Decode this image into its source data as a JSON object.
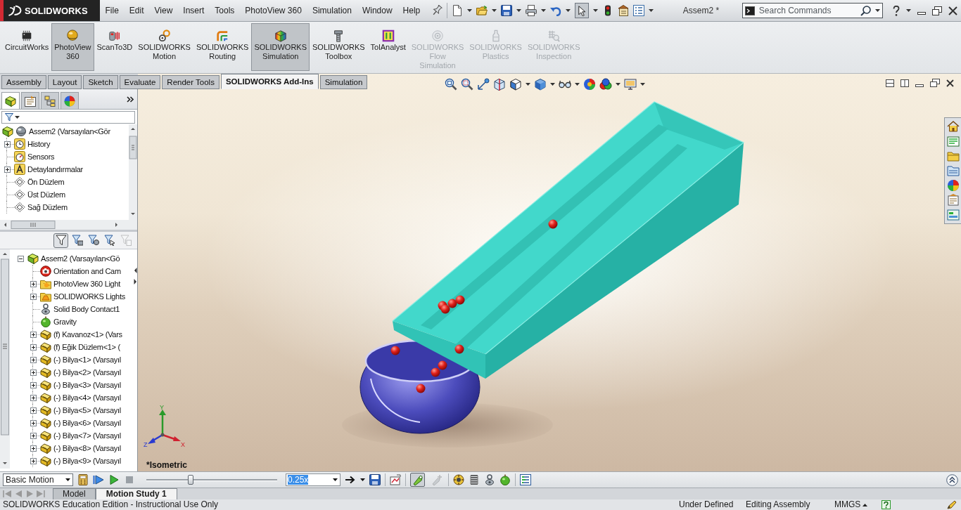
{
  "title_bar": {
    "logo": "SOLIDWORKS",
    "menu": [
      "File",
      "Edit",
      "View",
      "Insert",
      "Tools",
      "PhotoView 360",
      "Simulation",
      "Window",
      "Help"
    ],
    "select_tool_on": true,
    "document_title": "Assem2 *",
    "search": {
      "placeholder": "Search Commands"
    }
  },
  "command_manager": {
    "buttons": [
      {
        "label": "CircuitWorks",
        "selected": false,
        "disabled": false
      },
      {
        "label": "PhotoView 360",
        "selected": true,
        "disabled": false
      },
      {
        "label": "ScanTo3D",
        "selected": false,
        "disabled": false
      },
      {
        "label": "SOLIDWORKS Motion",
        "selected": false,
        "disabled": false
      },
      {
        "label": "SOLIDWORKS Routing",
        "selected": false,
        "disabled": false
      },
      {
        "label": "SOLIDWORKS Simulation",
        "selected": true,
        "disabled": false
      },
      {
        "label": "SOLIDWORKS Toolbox",
        "selected": false,
        "disabled": false
      },
      {
        "label": "TolAnalyst",
        "selected": false,
        "disabled": false
      },
      {
        "label": "SOLIDWORKS Flow Simulation",
        "selected": false,
        "disabled": true
      },
      {
        "label": "SOLIDWORKS Plastics",
        "selected": false,
        "disabled": true
      },
      {
        "label": "SOLIDWORKS Inspection",
        "selected": false,
        "disabled": true
      }
    ]
  },
  "tabs": [
    {
      "label": "Assembly",
      "selected": false
    },
    {
      "label": "Layout",
      "selected": false
    },
    {
      "label": "Sketch",
      "selected": false
    },
    {
      "label": "Evaluate",
      "selected": false
    },
    {
      "label": "Render Tools",
      "selected": false
    },
    {
      "label": "SOLIDWORKS Add-Ins",
      "selected": true
    },
    {
      "label": "Simulation",
      "selected": false
    }
  ],
  "feature_manager": {
    "panel_tabs": [
      {
        "selected": true
      },
      {
        "selected": false
      },
      {
        "selected": false
      },
      {
        "selected": false
      }
    ],
    "tree": [
      {
        "label": "Assem2 (Varsayılan<Gör",
        "kind": "root",
        "children": [
          {
            "label": "History",
            "kind": "history",
            "expanded": false
          },
          {
            "label": "Sensors",
            "kind": "sensors"
          },
          {
            "label": "Detaylandırmalar",
            "kind": "annotations",
            "expanded": false
          },
          {
            "label": "Ön Düzlem",
            "kind": "plane"
          },
          {
            "label": "Üst Düzlem",
            "kind": "plane"
          },
          {
            "label": "Sağ Düzlem",
            "kind": "plane"
          }
        ]
      }
    ]
  },
  "motion_manager": {
    "filters": [
      {
        "on": true,
        "disabled": false
      },
      {
        "on": false,
        "disabled": false
      },
      {
        "on": false,
        "disabled": false
      },
      {
        "on": false,
        "disabled": false
      },
      {
        "on": false,
        "disabled": true
      }
    ],
    "tree": [
      {
        "label": "Assem2 (Varsayılan<Gö",
        "kind": "assembly",
        "expanded": true,
        "children": [
          {
            "label": "Orientation and Cam",
            "kind": "orientation"
          },
          {
            "label": "PhotoView 360 Light",
            "kind": "lights",
            "expanded": false
          },
          {
            "label": "SOLIDWORKS Lights",
            "kind": "swlights",
            "expanded": false
          },
          {
            "label": "Solid Body Contact1",
            "kind": "contact"
          },
          {
            "label": "Gravity",
            "kind": "gravity"
          },
          {
            "label": "(f) Kavanoz<1> (Vars",
            "kind": "part",
            "expanded": false
          },
          {
            "label": "(f) Eğik Düzlem<1> (",
            "kind": "part",
            "expanded": false
          },
          {
            "label": "(-) Bilya<1> (Varsayıl",
            "kind": "part",
            "expanded": false
          },
          {
            "label": "(-) Bilya<2> (Varsayıl",
            "kind": "part",
            "expanded": false
          },
          {
            "label": "(-) Bilya<3> (Varsayıl",
            "kind": "part",
            "expanded": false
          },
          {
            "label": "(-) Bilya<4> (Varsayıl",
            "kind": "part",
            "expanded": false
          },
          {
            "label": "(-) Bilya<5> (Varsayıl",
            "kind": "part",
            "expanded": false
          },
          {
            "label": "(-) Bilya<6> (Varsayıl",
            "kind": "part",
            "expanded": false
          },
          {
            "label": "(-) Bilya<7> (Varsayıl",
            "kind": "part",
            "expanded": false
          },
          {
            "label": "(-) Bilya<8> (Varsayıl",
            "kind": "part",
            "expanded": false
          },
          {
            "label": "(-) Bilya<9> (Varsayıl",
            "kind": "part",
            "expanded": false
          }
        ]
      }
    ]
  },
  "viewport": {
    "triad_axes": [
      "Y",
      "X",
      "Z"
    ],
    "view_label": "*Isometric"
  },
  "motion_study_bar": {
    "study_type": "Basic Motion",
    "timeline": {
      "level": 0.34
    },
    "playback_speed": {
      "value": "0.25x",
      "selected": true
    },
    "autokey_on": true,
    "add_key_disabled": true
  },
  "study_tabs": [
    {
      "label": "Model",
      "selected": false
    },
    {
      "label": "Motion Study 1",
      "selected": true
    }
  ],
  "status_bar": {
    "message": "SOLIDWORKS Education Edition - Instructional Use Only",
    "fields": [
      "Under Defined",
      "Editing Assembly",
      "MMGS"
    ]
  }
}
